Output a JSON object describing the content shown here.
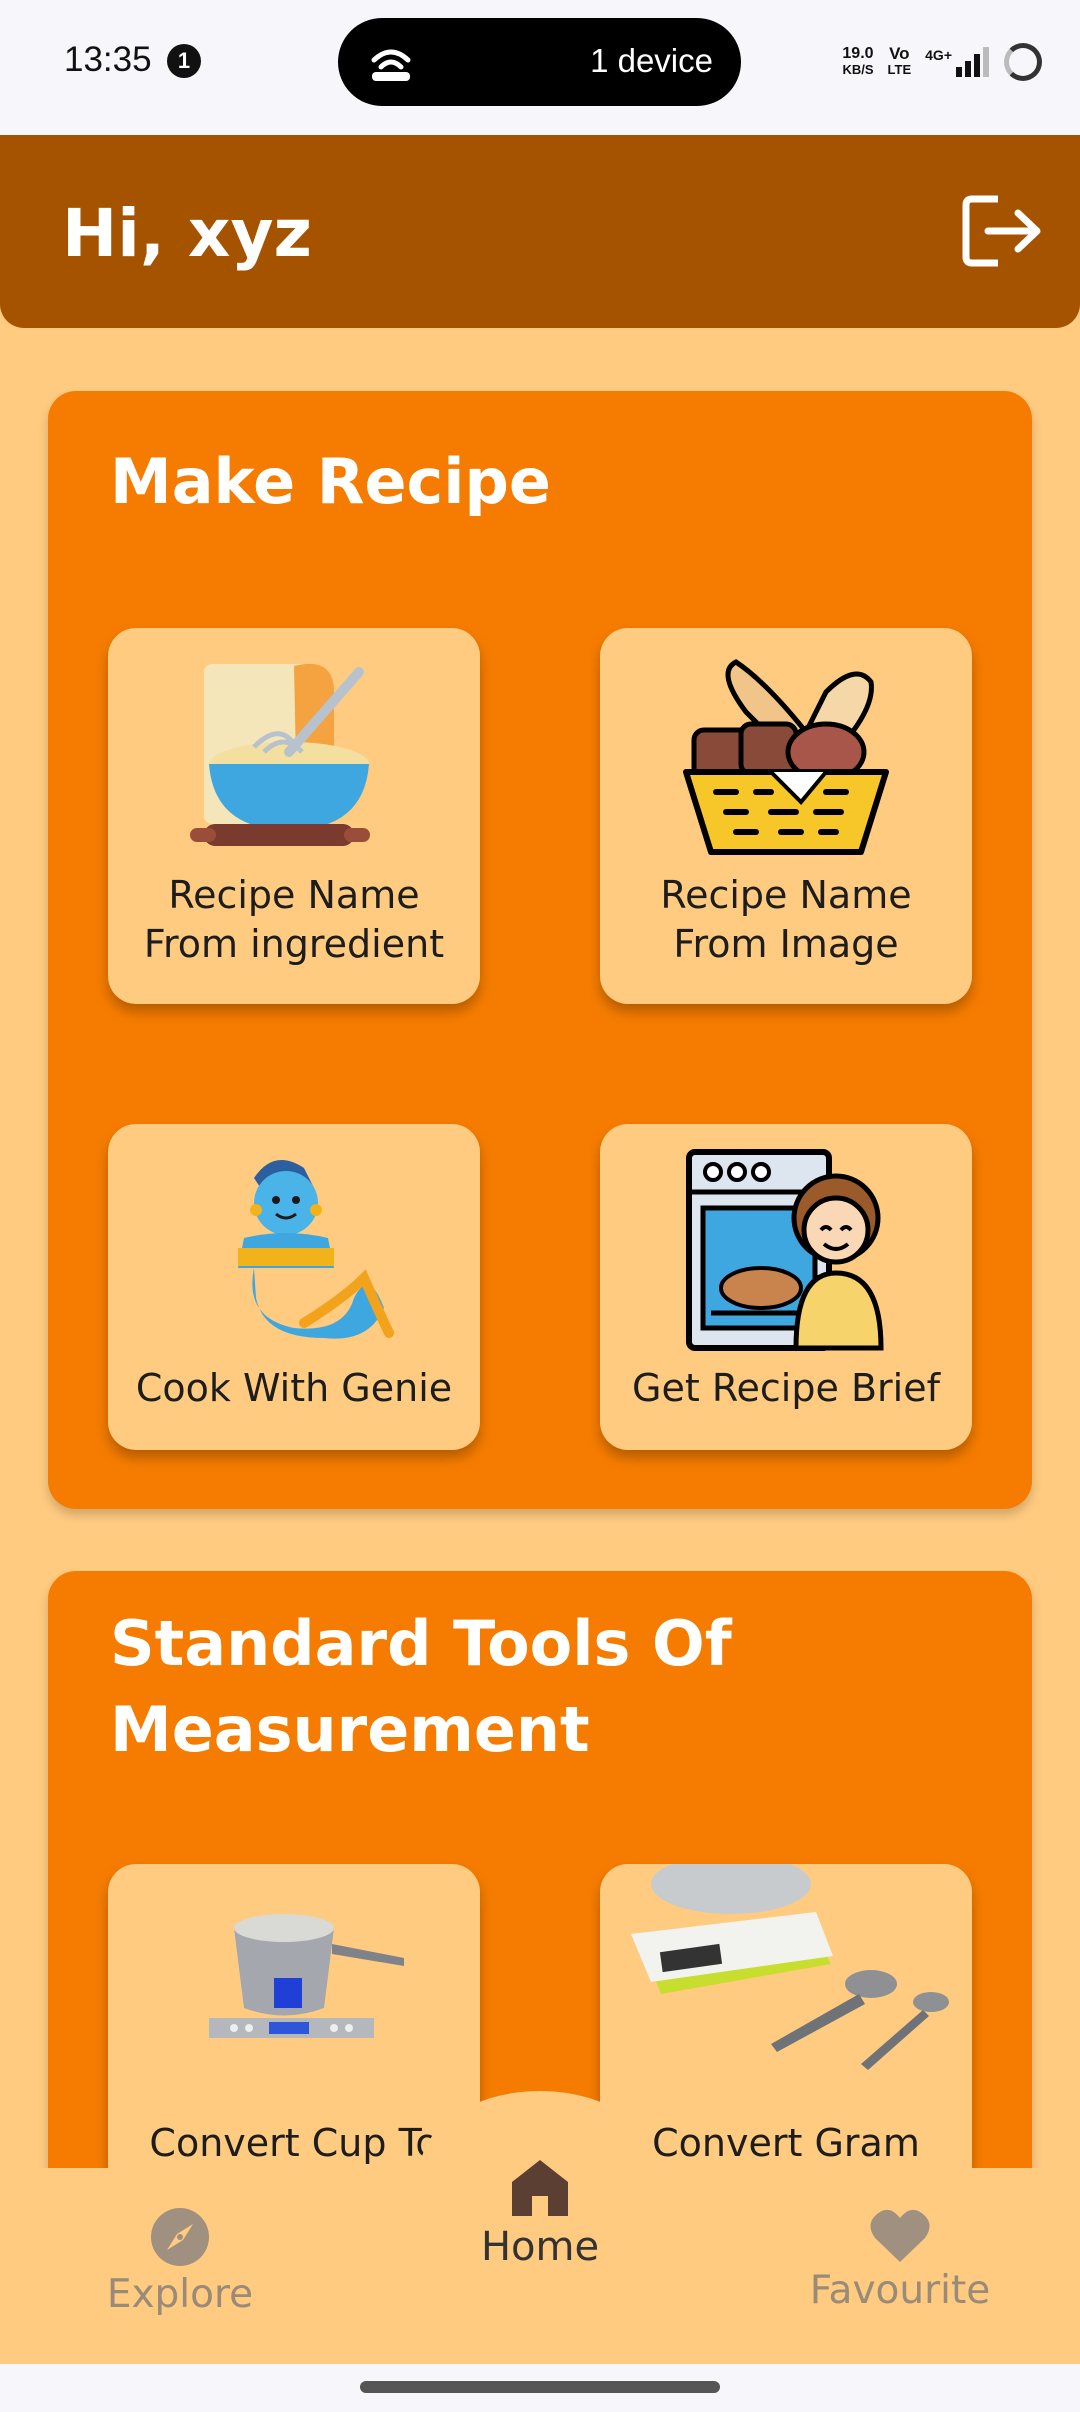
{
  "status_bar": {
    "time": "13:35",
    "notification_count": "1",
    "hotspot_text": "1 device",
    "net_speed_value": "19.0",
    "net_speed_unit": "KB/S",
    "volte_top": "Vo",
    "volte_bottom": "LTE",
    "network": "4G+"
  },
  "header": {
    "greeting": "Hi, xyz",
    "logout_icon": "logout-icon"
  },
  "make_recipe": {
    "title": "Make Recipe",
    "tiles": [
      {
        "line1": "Recipe Name",
        "line2": "From ingredient",
        "icon": "mixing-bowl-icon"
      },
      {
        "line1": "Recipe Name",
        "line2": "From Image",
        "icon": "bread-basket-icon"
      },
      {
        "line1": "Cook With Genie",
        "icon": "genie-icon"
      },
      {
        "line1": "Get Recipe Brief",
        "icon": "chef-oven-icon"
      }
    ]
  },
  "measurement": {
    "title_line1": "Standard Tools Of",
    "title_line2": "Measurement",
    "tiles": [
      {
        "line1": "Convert Cup To",
        "icon": "measuring-cup-scale-icon"
      },
      {
        "line1": "Convert Gram",
        "icon": "kitchen-scale-spoons-icon"
      }
    ]
  },
  "bottom_nav": {
    "items": [
      {
        "label": "Explore",
        "icon": "compass-icon"
      },
      {
        "label": "Home",
        "icon": "home-icon"
      },
      {
        "label": "Favourite",
        "icon": "heart-icon"
      }
    ]
  },
  "colors": {
    "header": "#A65300",
    "card": "#F57C00",
    "background": "#FFCB80"
  }
}
